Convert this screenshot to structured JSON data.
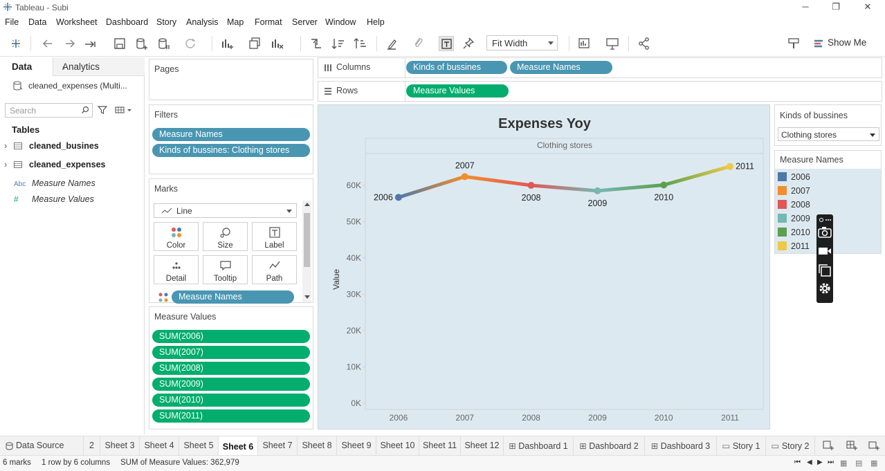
{
  "window": {
    "title": "Tableau - Subi"
  },
  "menu": [
    "File",
    "Data",
    "Worksheet",
    "Dashboard",
    "Story",
    "Analysis",
    "Map",
    "Format",
    "Server",
    "Window",
    "Help"
  ],
  "toolbar": {
    "fit": "Fit Width",
    "show_me": "Show Me"
  },
  "left_pane": {
    "tab_data": "Data",
    "tab_analytics": "Analytics",
    "datasource": "cleaned_expenses (Multi...",
    "search_placeholder": "Search",
    "tables_heading": "Tables",
    "tables": [
      "cleaned_busines",
      "cleaned_expenses"
    ],
    "fields": [
      {
        "icon": "Abc",
        "name": "Measure Names"
      },
      {
        "icon": "#",
        "name": "Measure Values"
      }
    ]
  },
  "pages": {
    "title": "Pages"
  },
  "filters": {
    "title": "Filters",
    "pills": [
      "Measure Names",
      "Kinds of bussines: Clothing stores"
    ]
  },
  "marks": {
    "title": "Marks",
    "type": "Line",
    "buttons": [
      "Color",
      "Size",
      "Label",
      "Detail",
      "Tooltip",
      "Path"
    ],
    "pill": "Measure Names"
  },
  "measure_values": {
    "title": "Measure Values",
    "pills": [
      "SUM(2006)",
      "SUM(2007)",
      "SUM(2008)",
      "SUM(2009)",
      "SUM(2010)",
      "SUM(2011)"
    ]
  },
  "shelves": {
    "columns_label": "Columns",
    "columns": [
      "Kinds of bussines",
      "Measure Names"
    ],
    "rows_label": "Rows",
    "rows": [
      "Measure Values"
    ]
  },
  "chart_data": {
    "type": "line",
    "title": "Expenses Yoy",
    "panel_header": "Clothing stores",
    "ylabel": "Value",
    "xlabel": "",
    "categories": [
      "2006",
      "2007",
      "2008",
      "2009",
      "2010",
      "2011"
    ],
    "values": [
      56700,
      62400,
      60000,
      58500,
      60100,
      65200
    ],
    "point_labels": [
      "2006",
      "2007",
      "2008",
      "2009",
      "2010",
      "2011"
    ],
    "colors": [
      "#4e79a7",
      "#f28e2b",
      "#e15759",
      "#76b7b2",
      "#59a14f",
      "#edc948"
    ],
    "yticks": [
      0,
      10000,
      20000,
      30000,
      40000,
      50000,
      60000
    ],
    "ytick_labels": [
      "0K",
      "10K",
      "20K",
      "30K",
      "40K",
      "50K",
      "60K"
    ],
    "ylim": [
      0,
      68000
    ],
    "grid": false
  },
  "filter_card": {
    "title": "Kinds of bussines",
    "value": "Clothing stores"
  },
  "legend": {
    "title": "Measure Names",
    "items": [
      {
        "label": "2006",
        "color": "#4e79a7"
      },
      {
        "label": "2007",
        "color": "#f28e2b"
      },
      {
        "label": "2008",
        "color": "#e15759"
      },
      {
        "label": "2009",
        "color": "#76b7b2"
      },
      {
        "label": "2010",
        "color": "#59a14f"
      },
      {
        "label": "2011",
        "color": "#edc948"
      }
    ]
  },
  "sheet_tabs": [
    "Data Source",
    "2",
    "Sheet 3",
    "Sheet 4",
    "Sheet 5",
    "Sheet 6",
    "Sheet 7",
    "Sheet 8",
    "Sheet 9",
    "Sheet 10",
    "Sheet 11",
    "Sheet 12",
    "Dashboard 1",
    "Dashboard 2",
    "Dashboard 3",
    "Story 1",
    "Story 2"
  ],
  "active_sheet": "Sheet 6",
  "status": {
    "marks": "6 marks",
    "rows_cols": "1 row by 6 columns",
    "sum": "SUM of Measure Values: 362,979"
  }
}
